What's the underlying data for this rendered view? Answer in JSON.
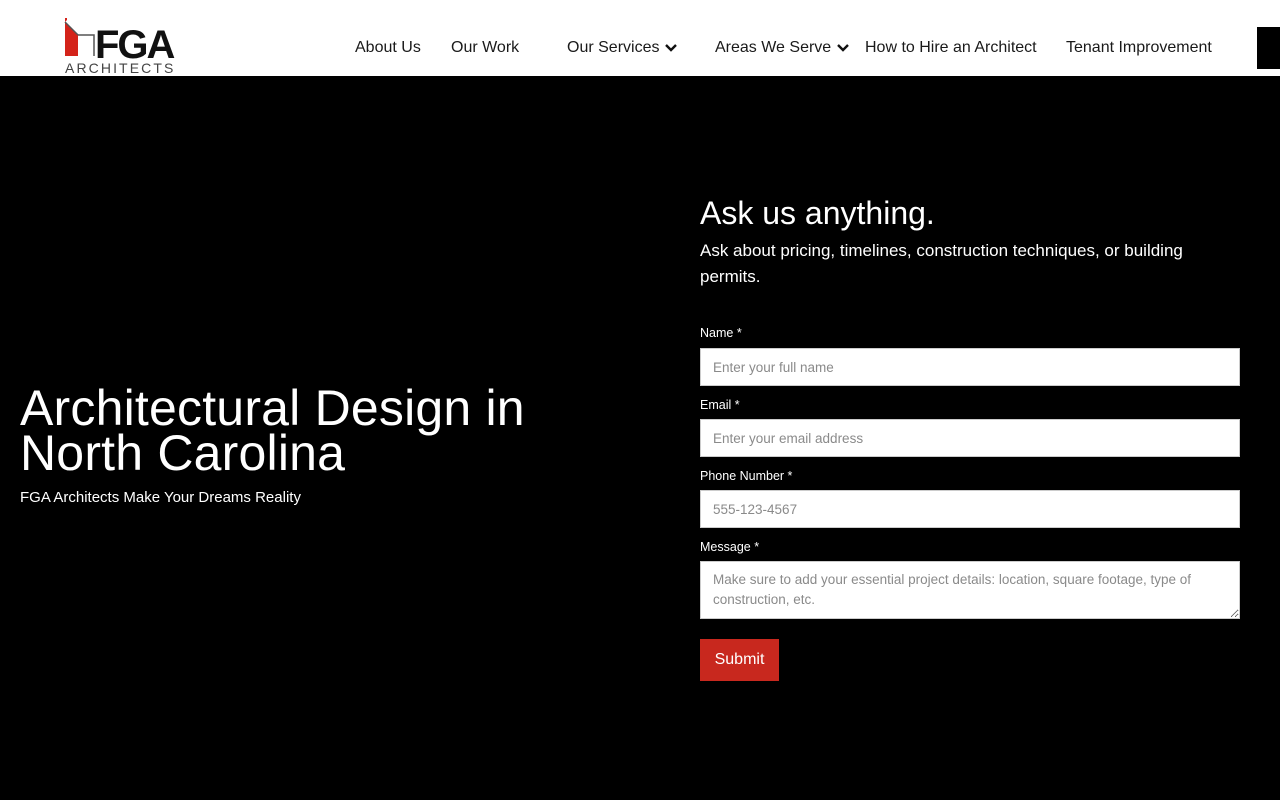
{
  "brand": {
    "logo_text": "FGA",
    "logo_subtext": "ARCHITECTS",
    "logo_accent_color": "#d4231a"
  },
  "nav": {
    "items": [
      {
        "label": "About Us",
        "dropdown": false
      },
      {
        "label": "Our Work",
        "dropdown": false
      },
      {
        "label": "Our Services",
        "dropdown": true
      },
      {
        "label": "Areas We Serve",
        "dropdown": true
      },
      {
        "label": "How to Hire an Architect",
        "dropdown": false
      },
      {
        "label": "Tenant Improvement",
        "dropdown": false
      }
    ]
  },
  "hero": {
    "title": "Architectural Design in North Carolina",
    "subtitle": "FGA Architects Make Your Dreams Reality"
  },
  "form": {
    "title": "Ask us anything.",
    "description": "Ask about pricing, timelines, construction techniques, or building permits.",
    "fields": {
      "name": {
        "label": "Name *",
        "placeholder": "Enter your full name"
      },
      "email": {
        "label": "Email *",
        "placeholder": "Enter your email address"
      },
      "phone": {
        "label": "Phone Number *",
        "placeholder": "555-123-4567"
      },
      "message": {
        "label": "Message *",
        "placeholder": "Make sure to add your essential project details: location, square footage, type of construction, etc."
      }
    },
    "submit_label": "Submit",
    "submit_color": "#c8281e"
  }
}
